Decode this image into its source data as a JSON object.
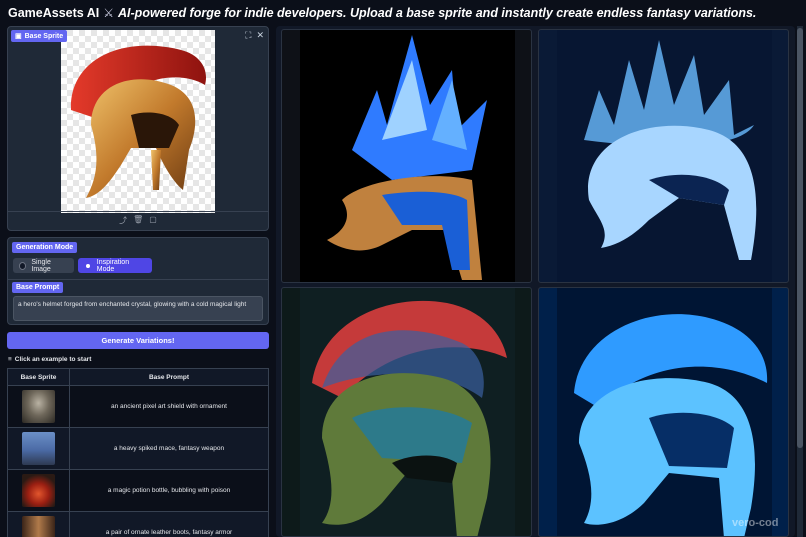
{
  "header": {
    "brand": "GameAssets AI",
    "icon": "crossed-swords-icon",
    "tagline": "AI-powered forge for indie developers. Upload a base sprite and instantly create endless fantasy variations."
  },
  "sprite": {
    "label": "Base Sprite",
    "label_icon": "image-icon",
    "corner_icons": [
      "fullscreen-icon",
      "close-icon"
    ],
    "toolbar_icons": [
      "upload-icon",
      "trash-icon",
      "clipboard-icon"
    ]
  },
  "mode": {
    "label": "Generation Mode",
    "options": [
      "Single Image",
      "Inspiration Mode"
    ],
    "selected": "Inspiration Mode"
  },
  "prompt": {
    "label": "Base Prompt",
    "value": "a hero's helmet forged from enchanted crystal, glowing with a cold magical light"
  },
  "generate_label": "Generate Variations!",
  "examples": {
    "label": "Click an example to start",
    "columns": [
      "Base Sprite",
      "Base Prompt"
    ],
    "rows": [
      {
        "prompt": "an ancient pixel art shield with ornament",
        "thumb": "shield"
      },
      {
        "prompt": "a heavy spiked mace, fantasy weapon",
        "thumb": "mace"
      },
      {
        "prompt": "a magic potion bottle, bubbling with poison",
        "thumb": "potion"
      },
      {
        "prompt": "a pair of ornate leather boots, fantasy armor",
        "thumb": "boots"
      }
    ]
  },
  "gallery": {
    "images": [
      "crystal-spiked-helmet",
      "ice-spiked-helmet",
      "mossy-red-crest-helmet",
      "glowing-blue-helmet"
    ]
  },
  "watermark": "vero-cod",
  "colors": {
    "accent": "#6366f1",
    "background": "#0b0f19",
    "panel": "#1f2937"
  }
}
